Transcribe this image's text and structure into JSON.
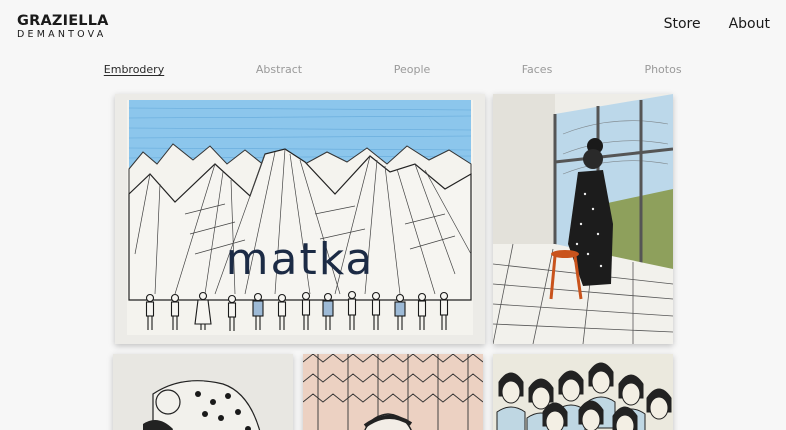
{
  "brand": {
    "name": "GRAZIELLA",
    "surname": "DEMANTOVA"
  },
  "nav": [
    {
      "label": "Store"
    },
    {
      "label": "About"
    }
  ],
  "categories": [
    {
      "label": "Embrodery",
      "active": true
    },
    {
      "label": "Abstract",
      "active": false
    },
    {
      "label": "People",
      "active": false
    },
    {
      "label": "Faces",
      "active": false
    },
    {
      "label": "Photos",
      "active": false
    }
  ],
  "gallery": {
    "artwork_main_text": "matka"
  },
  "colors": {
    "background": "#f7f7f7",
    "text": "#1a1a1a",
    "muted": "#9a9a9a",
    "sky": "#7cb9df"
  }
}
